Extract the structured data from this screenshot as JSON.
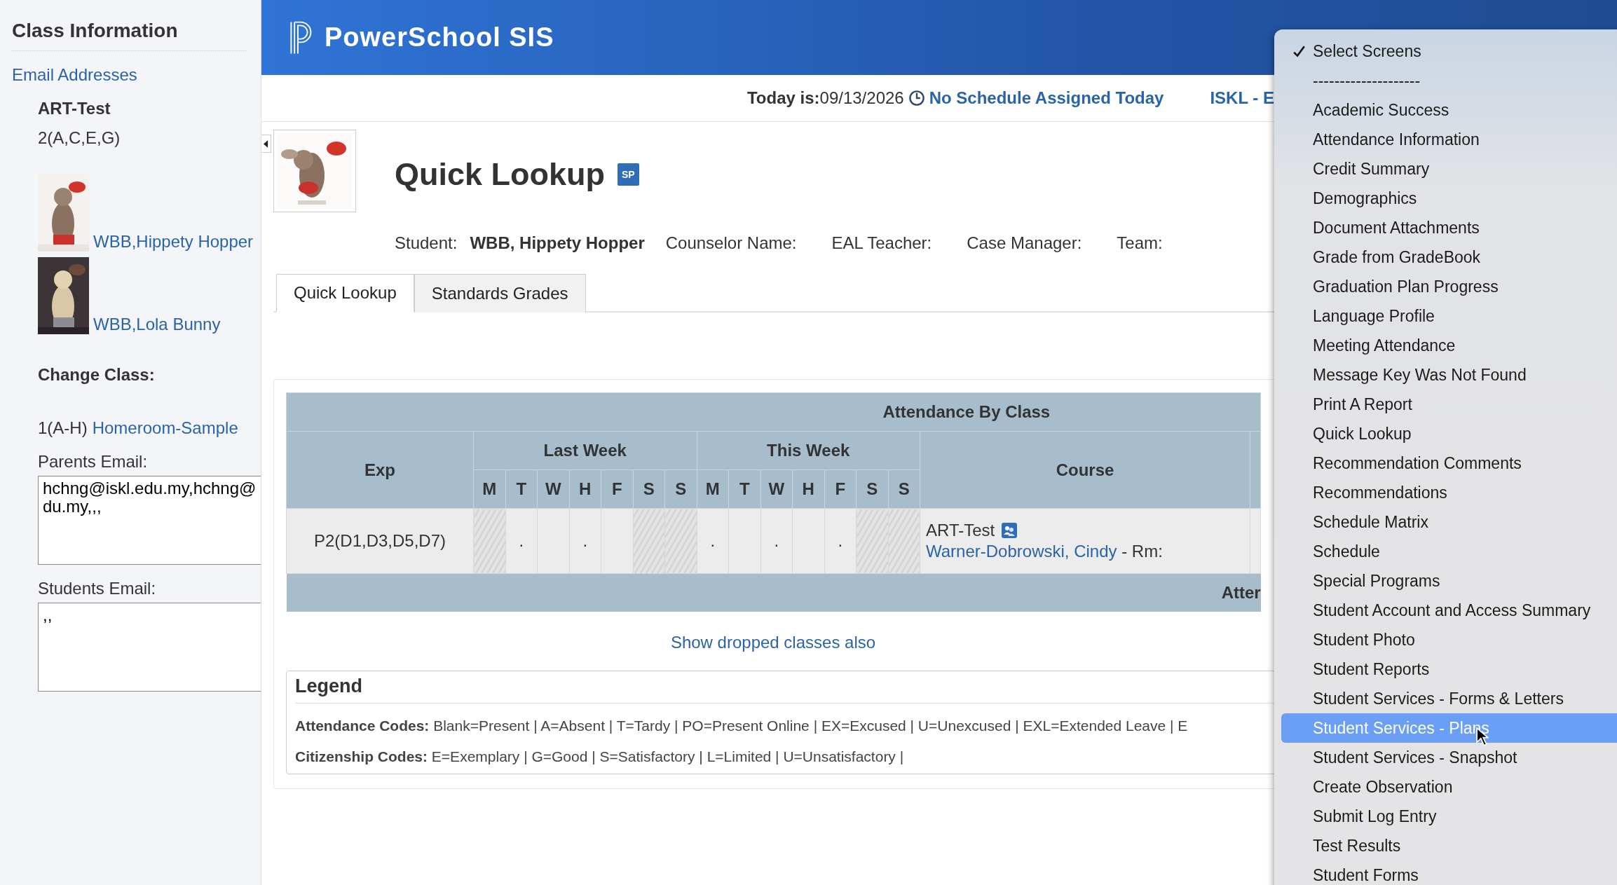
{
  "sidebar": {
    "title": "Class Information",
    "link": "Email Addresses",
    "class_name": "ART-Test",
    "class_period": "2(A,C,E,G)",
    "students": [
      {
        "name": "WBB,Hippety Hopper"
      },
      {
        "name": "WBB,Lola Bunny"
      }
    ],
    "change_class_label": "Change Class:",
    "change_class": {
      "period": "1(A-H)",
      "link": "Homeroom-Sample"
    },
    "parents_email": {
      "label": "Parents Email:",
      "lines": [
        "hchng@iskl.edu.my,hchng@",
        "du.my,,,"
      ]
    },
    "students_email": {
      "label": "Students Email:",
      "lines": [
        ",,"
      ]
    }
  },
  "header": {
    "brand": "PowerSchool SIS"
  },
  "date_bar": {
    "today": "**Today is:**09/13/2026",
    "schedule_link": "No Schedule Assigned Today",
    "school": "ISKL - E"
  },
  "page": {
    "title": "Quick Lookup",
    "badge": "SP",
    "info": [
      {
        "label": "Student:",
        "value": "WBB, Hippety Hopper"
      },
      {
        "label": "Counselor Name:"
      },
      {
        "label": "EAL Teacher:"
      },
      {
        "label": "Case Manager:"
      },
      {
        "label": "Team:"
      }
    ],
    "tabs": [
      {
        "label": "Quick Lookup",
        "selected": true
      },
      {
        "label": "Standards Grades",
        "selected": false
      }
    ]
  },
  "attendance": {
    "title": "Attendance By Class",
    "exp_header": "Exp",
    "course_header": "Course",
    "weeks": [
      {
        "label": "Last Week",
        "days": [
          "M",
          "T",
          "W",
          "H",
          "F",
          "S",
          "S"
        ]
      },
      {
        "label": "This Week",
        "days": [
          "M",
          "T",
          "W",
          "H",
          "F",
          "S",
          "S"
        ]
      }
    ],
    "rows": [
      {
        "exp": "P2(D1,D3,D5,D7)",
        "course": "ART-Test",
        "teacher": "Warner-Dobrowski, Cindy",
        "room": "- Rm:",
        "cells": [
          {
            "kind": "hatched"
          },
          {
            "kind": "day",
            "text": "."
          },
          {
            "kind": "day"
          },
          {
            "kind": "day",
            "text": "."
          },
          {
            "kind": "day"
          },
          {
            "kind": "hatched"
          },
          {
            "kind": "hatched"
          },
          {
            "kind": "day",
            "text": "."
          },
          {
            "kind": "day"
          },
          {
            "kind": "day",
            "text": "."
          },
          {
            "kind": "day"
          },
          {
            "kind": "day",
            "text": "."
          },
          {
            "kind": "hatched"
          },
          {
            "kind": "hatched"
          }
        ]
      }
    ],
    "footer": "Atter"
  },
  "show_dropped_link": "Show dropped classes also",
  "legend": {
    "title": "Legend",
    "lines": [
      "**Attendance Codes:** Blank=Present | A=Absent | T=Tardy | PO=Present Online | EX=Excused | U=Unexcused | EXL=Extended Leave | E",
      "**Citizenship Codes:** E=Exemplary | G=Good | S=Satisfactory | L=Limited | U=Unsatisfactory |"
    ]
  },
  "menu": {
    "items": [
      {
        "label": "Select Screens",
        "checked": true,
        "selected": false
      },
      {
        "label": "--------------------",
        "checked": false,
        "selected": false
      },
      {
        "label": "Academic Success",
        "checked": false,
        "selected": false
      },
      {
        "label": "Attendance Information",
        "checked": false,
        "selected": false
      },
      {
        "label": "Credit Summary",
        "checked": false,
        "selected": false
      },
      {
        "label": "Demographics",
        "checked": false,
        "selected": false
      },
      {
        "label": "Document Attachments",
        "checked": false,
        "selected": false
      },
      {
        "label": "Grade from GradeBook",
        "checked": false,
        "selected": false
      },
      {
        "label": "Graduation Plan Progress",
        "checked": false,
        "selected": false
      },
      {
        "label": "Language Profile",
        "checked": false,
        "selected": false
      },
      {
        "label": "Meeting Attendance",
        "checked": false,
        "selected": false
      },
      {
        "label": "Message Key Was Not Found",
        "checked": false,
        "selected": false
      },
      {
        "label": "Print A Report",
        "checked": false,
        "selected": false
      },
      {
        "label": "Quick Lookup",
        "checked": false,
        "selected": false
      },
      {
        "label": "Recommendation Comments",
        "checked": false,
        "selected": false
      },
      {
        "label": "Recommendations",
        "checked": false,
        "selected": false
      },
      {
        "label": "Schedule Matrix",
        "checked": false,
        "selected": false
      },
      {
        "label": "Schedule",
        "checked": false,
        "selected": false
      },
      {
        "label": "Special Programs",
        "checked": false,
        "selected": false
      },
      {
        "label": "Student Account and Access Summary",
        "checked": false,
        "selected": false
      },
      {
        "label": "Student Photo",
        "checked": false,
        "selected": false
      },
      {
        "label": "Student Reports",
        "checked": false,
        "selected": false
      },
      {
        "label": "Student Services - Forms & Letters",
        "checked": false,
        "selected": false
      },
      {
        "label": "Student Services - Plans",
        "checked": false,
        "selected": true
      },
      {
        "label": "Student Services - Snapshot",
        "checked": false,
        "selected": false
      },
      {
        "label": "Create Observation",
        "checked": false,
        "selected": false
      },
      {
        "label": "Submit Log Entry",
        "checked": false,
        "selected": false
      },
      {
        "label": "Test Results",
        "checked": false,
        "selected": false
      },
      {
        "label": "Student Forms",
        "checked": false,
        "selected": false
      }
    ]
  }
}
